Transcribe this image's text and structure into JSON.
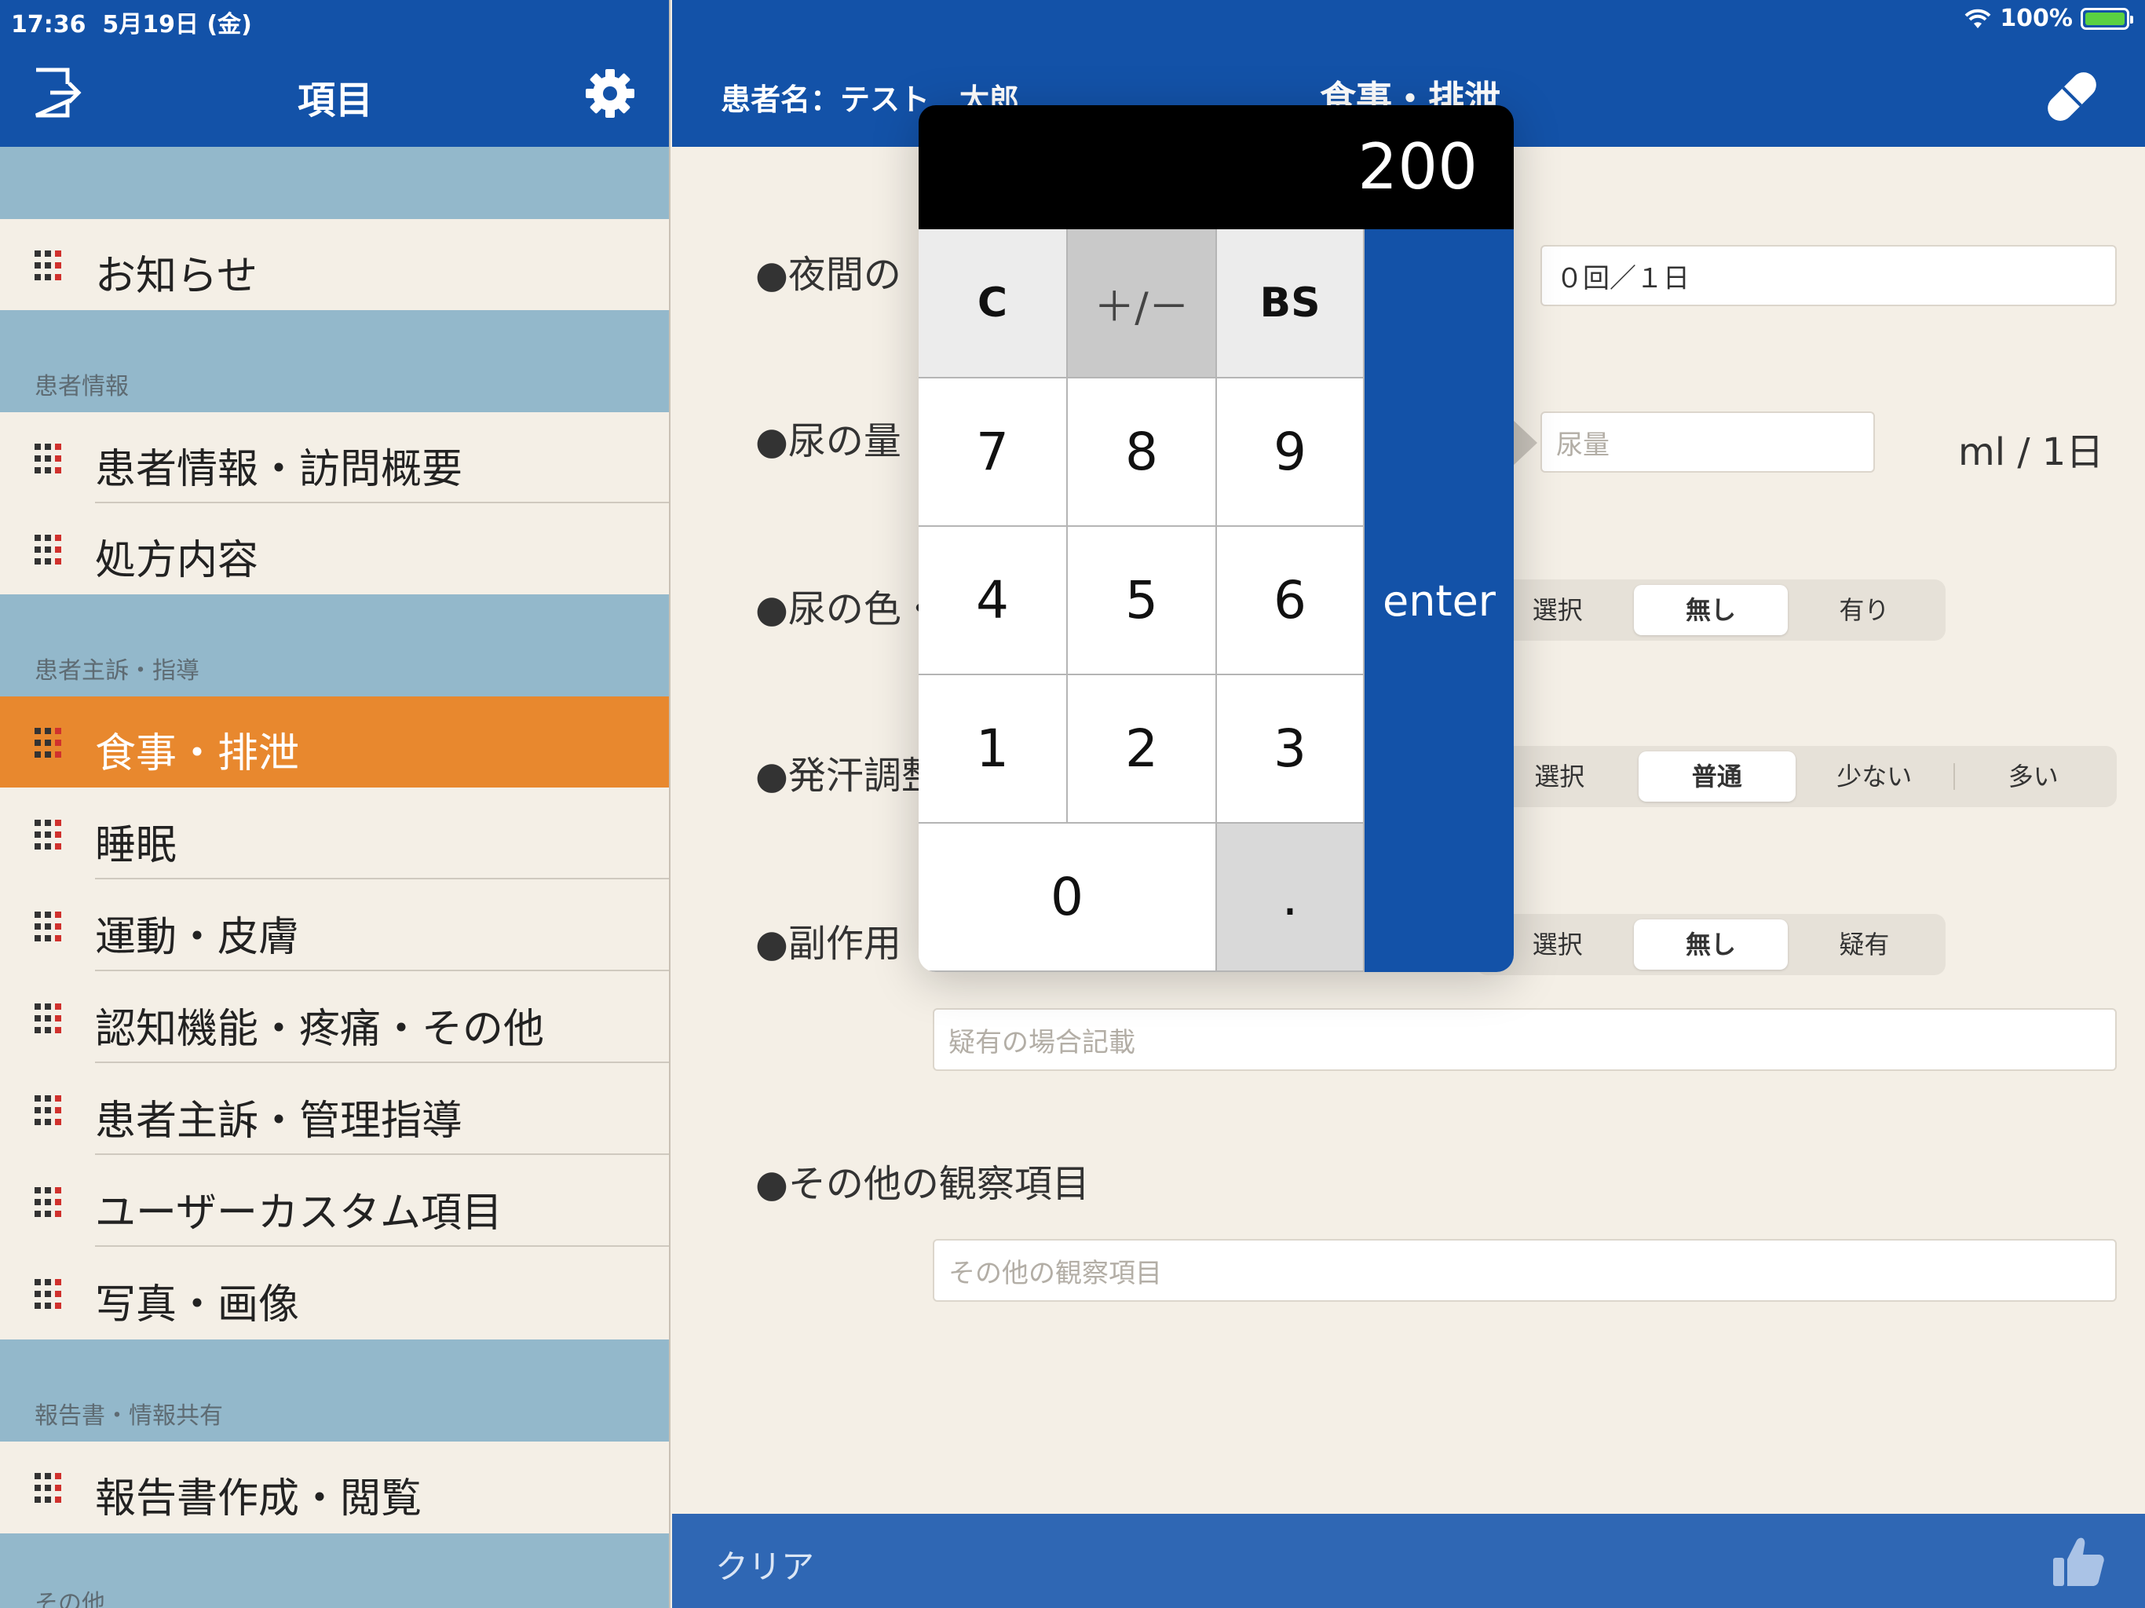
{
  "status": {
    "time": "17:36",
    "date": "5月19日 (金)",
    "battery": "100%"
  },
  "sidebar": {
    "title": "項目",
    "items": {
      "notice": "お知らせ",
      "patient_info": "患者情報・訪問概要",
      "prescription": "処方内容",
      "meals": "食事・排泄",
      "sleep": "睡眠",
      "exercise": "運動・皮膚",
      "cognitive": "認知機能・疼痛・その他",
      "complaint": "患者主訴・管理指導",
      "custom": "ユーザーカスタム項目",
      "photo": "写真・画像",
      "report": "報告書作成・閲覧"
    },
    "sections": {
      "patient": "患者情報",
      "complaints": "患者主訴・指導",
      "report": "報告書・情報共有",
      "other": "その他"
    }
  },
  "header": {
    "patient": "患者名：テスト　太郎",
    "title": "食事・排泄"
  },
  "form": {
    "q1": "●夜間の",
    "q1_value": "０回／１日",
    "q2": "●尿の量",
    "q2_placeholder": "尿量",
    "q2_unit": "ml / 1日",
    "q3": "●尿の色・",
    "q4": "●発汗調整",
    "q5": "●副作用",
    "q5_placeholder": "疑有の場合記載",
    "q6": "●その他の観察項目",
    "q6_placeholder": "その他の観察項目",
    "seg_color": [
      "選択",
      "無し",
      "有り"
    ],
    "seg_sweat": [
      "選択",
      "普通",
      "少ない",
      "多い"
    ],
    "seg_side": [
      "選択",
      "無し",
      "疑有"
    ]
  },
  "calculator": {
    "display": "200",
    "keys": {
      "clear": "C",
      "plusminus": "＋/－",
      "backspace": "BS",
      "enter": "enter",
      "dot": "."
    },
    "digits": [
      "0",
      "1",
      "2",
      "3",
      "4",
      "5",
      "6",
      "7",
      "8",
      "9"
    ]
  },
  "bottom": {
    "clear": "クリア"
  },
  "colors": {
    "header_blue": "#1352a8",
    "active_orange": "#e8882e",
    "section_blue": "#93b8cb",
    "background": "#f4efe6"
  }
}
